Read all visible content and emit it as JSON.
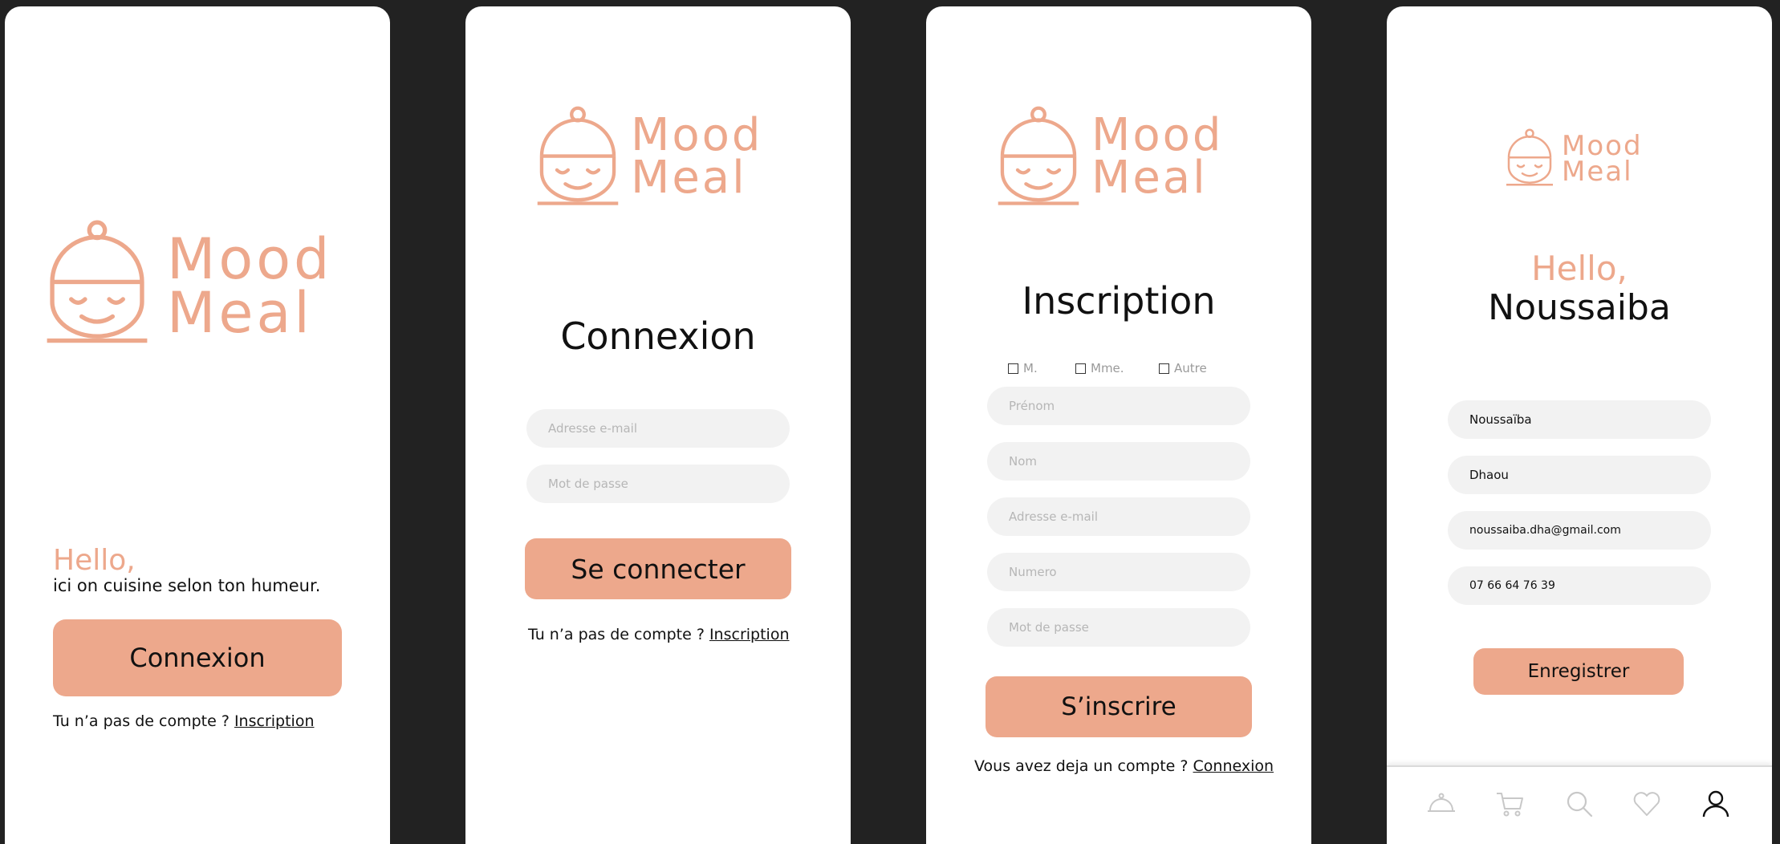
{
  "brand": {
    "line1": "Mood",
    "line2": "Meal",
    "color": "#EDA88C"
  },
  "welcome": {
    "greeting": "Hello,",
    "tagline": "ici on cuisine selon ton humeur.",
    "login_button": "Connexion",
    "no_account_text": "Tu n’a pas de compte ?",
    "signup_link": "Inscription"
  },
  "login": {
    "title": "Connexion",
    "email_placeholder": "Adresse e-mail",
    "password_placeholder": "Mot de passe",
    "submit_button": "Se connecter",
    "no_account_text": "Tu n’a pas de compte ?",
    "signup_link": "Inscription"
  },
  "signup": {
    "title": "Inscription",
    "gender_options": [
      "M.",
      "Mme.",
      "Autre"
    ],
    "firstname_placeholder": "Prénom",
    "lastname_placeholder": "Nom",
    "email_placeholder": "Adresse e-mail",
    "phone_placeholder": "Numero",
    "password_placeholder": "Mot de passe",
    "submit_button": "S’inscrire",
    "have_account_text": "Vous avez deja un compte ?",
    "login_link": "Connexion"
  },
  "profile": {
    "greeting": "Hello,",
    "name": "Noussaiba",
    "firstname_value": "Noussaïba",
    "lastname_value": "Dhaou",
    "email_value": "noussaiba.dha@gmail.com",
    "phone_value": "07 66 64 76 39",
    "save_button": "Enregistrer",
    "tabs": [
      "cloche-icon",
      "cart-icon",
      "search-icon",
      "heart-icon",
      "user-icon"
    ]
  }
}
